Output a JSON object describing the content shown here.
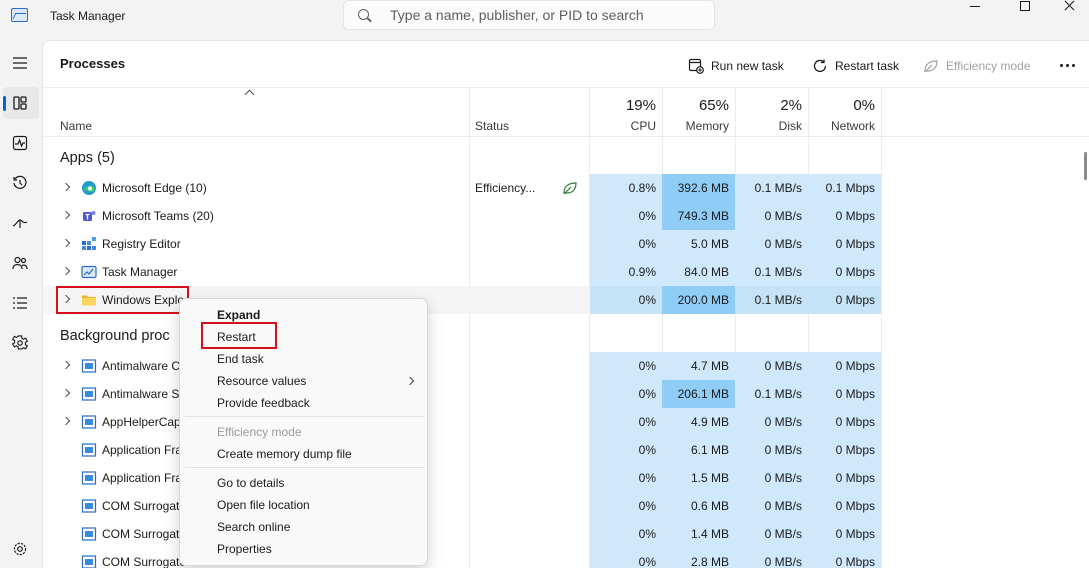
{
  "window": {
    "title": "Task Manager"
  },
  "search": {
    "placeholder": "Type a name, publisher, or PID to search"
  },
  "sidebar": {
    "items": [
      {
        "icon": "hamburger-icon"
      },
      {
        "icon": "processes-icon",
        "active": true
      },
      {
        "icon": "performance-icon"
      },
      {
        "icon": "app-history-icon"
      },
      {
        "icon": "startup-apps-icon"
      },
      {
        "icon": "users-icon"
      },
      {
        "icon": "details-icon"
      },
      {
        "icon": "services-icon"
      },
      {
        "icon": "settings-icon"
      }
    ]
  },
  "page": {
    "title": "Processes"
  },
  "toolbar": {
    "run_new_task": "Run new task",
    "restart_task": "Restart task",
    "efficiency_mode": "Efficiency mode"
  },
  "columns": {
    "name": "Name",
    "status": "Status",
    "cpu_pct": "19%",
    "cpu": "CPU",
    "memory_pct": "65%",
    "memory": "Memory",
    "disk_pct": "2%",
    "disk": "Disk",
    "network_pct": "0%",
    "network": "Network"
  },
  "groups": {
    "apps": "Apps (5)",
    "background": "Background proc"
  },
  "apps": [
    {
      "name": "Microsoft Edge (10)",
      "status": "Efficiency...",
      "cpu": "0.8%",
      "memory": "392.6 MB",
      "disk": "0.1 MB/s",
      "network": "0.1 Mbps",
      "icon": "edge-icon"
    },
    {
      "name": "Microsoft Teams (20)",
      "status": "",
      "cpu": "0%",
      "memory": "749.3 MB",
      "disk": "0 MB/s",
      "network": "0 Mbps",
      "icon": "teams-icon"
    },
    {
      "name": "Registry Editor",
      "status": "",
      "cpu": "0%",
      "memory": "5.0 MB",
      "disk": "0 MB/s",
      "network": "0 Mbps",
      "icon": "registry-editor-icon"
    },
    {
      "name": "Task Manager",
      "status": "",
      "cpu": "0.9%",
      "memory": "84.0 MB",
      "disk": "0.1 MB/s",
      "network": "0 Mbps",
      "icon": "task-manager-icon"
    },
    {
      "name": "Windows Explo",
      "status": "",
      "cpu": "0%",
      "memory": "200.0 MB",
      "disk": "0.1 MB/s",
      "network": "0 Mbps",
      "icon": "folder-icon"
    }
  ],
  "background": [
    {
      "name": "Antimalware C",
      "cpu": "0%",
      "memory": "4.7 MB",
      "disk": "0 MB/s",
      "network": "0 Mbps"
    },
    {
      "name": "Antimalware S",
      "cpu": "0%",
      "memory": "206.1 MB",
      "disk": "0.1 MB/s",
      "network": "0 Mbps"
    },
    {
      "name": "AppHelperCap",
      "cpu": "0%",
      "memory": "4.9 MB",
      "disk": "0 MB/s",
      "network": "0 Mbps"
    },
    {
      "name": "Application Fra",
      "cpu": "0%",
      "memory": "6.1 MB",
      "disk": "0 MB/s",
      "network": "0 Mbps"
    },
    {
      "name": "Application Fra",
      "cpu": "0%",
      "memory": "1.5 MB",
      "disk": "0 MB/s",
      "network": "0 Mbps"
    },
    {
      "name": "COM Surrogat",
      "cpu": "0%",
      "memory": "0.6 MB",
      "disk": "0 MB/s",
      "network": "0 Mbps"
    },
    {
      "name": "COM Surrogat",
      "cpu": "0%",
      "memory": "1.4 MB",
      "disk": "0 MB/s",
      "network": "0 Mbps"
    },
    {
      "name": "COM Surrogate",
      "cpu": "0%",
      "memory": "2.8 MB",
      "disk": "0 MB/s",
      "network": "0 Mbps"
    }
  ],
  "context_menu": {
    "expand": "Expand",
    "restart": "Restart",
    "end_task": "End task",
    "resource_values": "Resource values",
    "provide_feedback": "Provide feedback",
    "efficiency_mode": "Efficiency mode",
    "create_dump": "Create memory dump file",
    "go_to_details": "Go to details",
    "open_file_location": "Open file location",
    "search_online": "Search online",
    "properties": "Properties"
  },
  "colors": {
    "accent": "#0a64c8",
    "heat_light": "#cfe8fc",
    "heat_strong": "#8fcdf7",
    "highlight": "#d4101c"
  }
}
